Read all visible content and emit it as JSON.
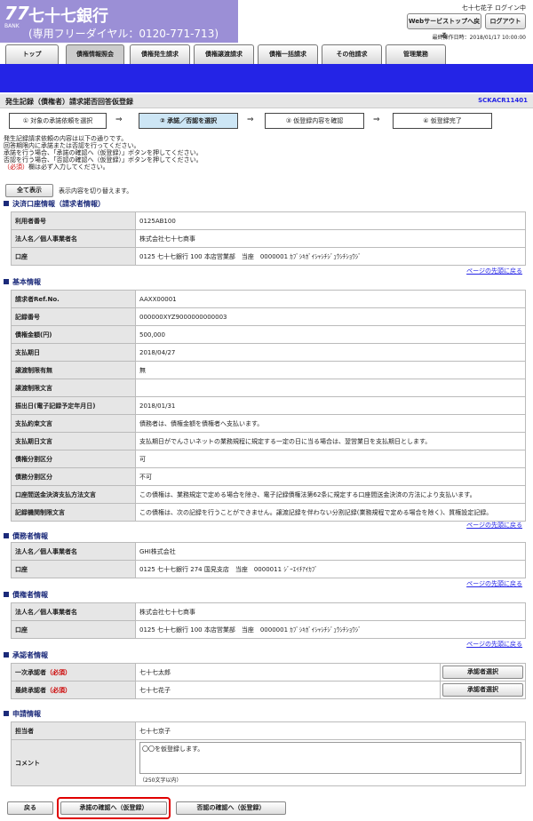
{
  "header": {
    "logo_num": "77",
    "logo_bank": "BANK",
    "bank_name": "七十七銀行",
    "free_dial": "(専用フリーダイヤル：0120-771-713)",
    "user_status": "七十七花子 ログイン中",
    "web_top": "Webサービストップへ戻る",
    "logout": "ログアウト",
    "last_time": "最終操作日時：2018/01/17 10:00:00"
  },
  "tabs": [
    "トップ",
    "債権情報照会",
    "債権発生請求",
    "債権譲渡請求",
    "債権一括請求",
    "その他請求",
    "管理業務"
  ],
  "page": {
    "title": "発生記録（債権者）請求諾否回答仮登録",
    "screen_id": "SCKACR11401"
  },
  "steps": [
    "① 対象の承諾依頼を選択",
    "② 承諾／否認を選択",
    "③ 仮登録内容を確認",
    "④ 仮登録完了"
  ],
  "messages": [
    "発生記録請求依頼の内容は以下の通りです。",
    "回答期限内に承諾または否認を行ってください。",
    "承諾を行う場合、「承諾の確認へ（仮登録）」ボタンを押してください。",
    "否認を行う場合、「否認の確認へ（仮登録）」ボタンを押してください。"
  ],
  "required_mark": "（必須）",
  "required_text": "欄は必ず入力してください。",
  "show_all": "全て表示",
  "show_all_desc": "表示内容を切り替えます。",
  "to_top": "ページの先頭に戻る",
  "sec1": {
    "title": "決済口座情報（請求者情報）",
    "rows": [
      [
        "利用者番号",
        "0125AB100"
      ],
      [
        "法人名／個人事業者名",
        "株式会社七十七商事"
      ],
      [
        "口座",
        "0125 七十七銀行 100 本店営業部　当座　0000001 ｶﾌﾞｼｷｶﾞｲｼｬｼﾁｼﾞｭｳｼﾁｼｮｳｼﾞ"
      ]
    ]
  },
  "sec2": {
    "title": "基本情報",
    "rows": [
      [
        "請求者Ref.No.",
        "AAXX00001"
      ],
      [
        "記録番号",
        "000000XYZ9000000000003"
      ],
      [
        "債権金額(円)",
        "500,000"
      ],
      [
        "支払期日",
        "2018/04/27"
      ],
      [
        "譲渡制限有無",
        "無"
      ],
      [
        "譲渡制限文言",
        ""
      ],
      [
        "振出日(電子記録予定年月日)",
        "2018/01/31"
      ],
      [
        "支払約束文言",
        "債務者は、債権金額を債権者へ支払います。"
      ],
      [
        "支払期日文言",
        "支払期日がでんさいネットの業務規程に規定する一定の日に当る場合は、翌営業日を支払期日とします。"
      ],
      [
        "債権分割区分",
        "可"
      ],
      [
        "債務分割区分",
        "不可"
      ],
      [
        "口座間送金決済支払方法文言",
        "この債権は、業務規定で定める場合を除き、電子記録債権法第62条に規定する口座間送金決済の方法により支払います。"
      ],
      [
        "記録機関制限文言",
        "この債権は、次の記録を行うことができません。譲渡記録を伴わない分割記録(業務規程で定める場合を除く)、質権設定記録。"
      ]
    ]
  },
  "sec3": {
    "title": "債務者情報",
    "rows": [
      [
        "法人名／個人事業者名",
        "GHI株式会社"
      ],
      [
        "口座",
        "0125 七十七銀行 274 国見支店　当座　0000011 ｼﾞｰｴｲﾁｱｲｶﾌﾞ"
      ]
    ]
  },
  "sec4": {
    "title": "債権者情報",
    "rows": [
      [
        "法人名／個人事業者名",
        "株式会社七十七商事"
      ],
      [
        "口座",
        "0125 七十七銀行 100 本店営業部　当座　0000001 ｶﾌﾞｼｷｶﾞｲｼｬｼﾁｼﾞｭｳｼﾁｼｮｳｼﾞ"
      ]
    ]
  },
  "sec5": {
    "title": "承認者情報",
    "rows": [
      {
        "k": "一次承認者",
        "v": "七十七太郎",
        "btn": "承認者選択"
      },
      {
        "k": "最終承認者",
        "v": "七十七花子",
        "btn": "承認者選択"
      }
    ]
  },
  "sec6": {
    "title": "申請情報",
    "staff_k": "担当者",
    "staff_v": "七十七京子",
    "comment_k": "コメント",
    "comment_v": "〇〇を仮登録します。",
    "comment_limit": "（250文字以内）"
  },
  "buttons": {
    "back": "戻る",
    "approve": "承諾の確認へ（仮登録）",
    "deny": "否認の確認へ（仮登録）"
  },
  "colors": {
    "brand": "#9b8fd6",
    "bluebar": "#2424e6",
    "highlight": "#e00000"
  }
}
